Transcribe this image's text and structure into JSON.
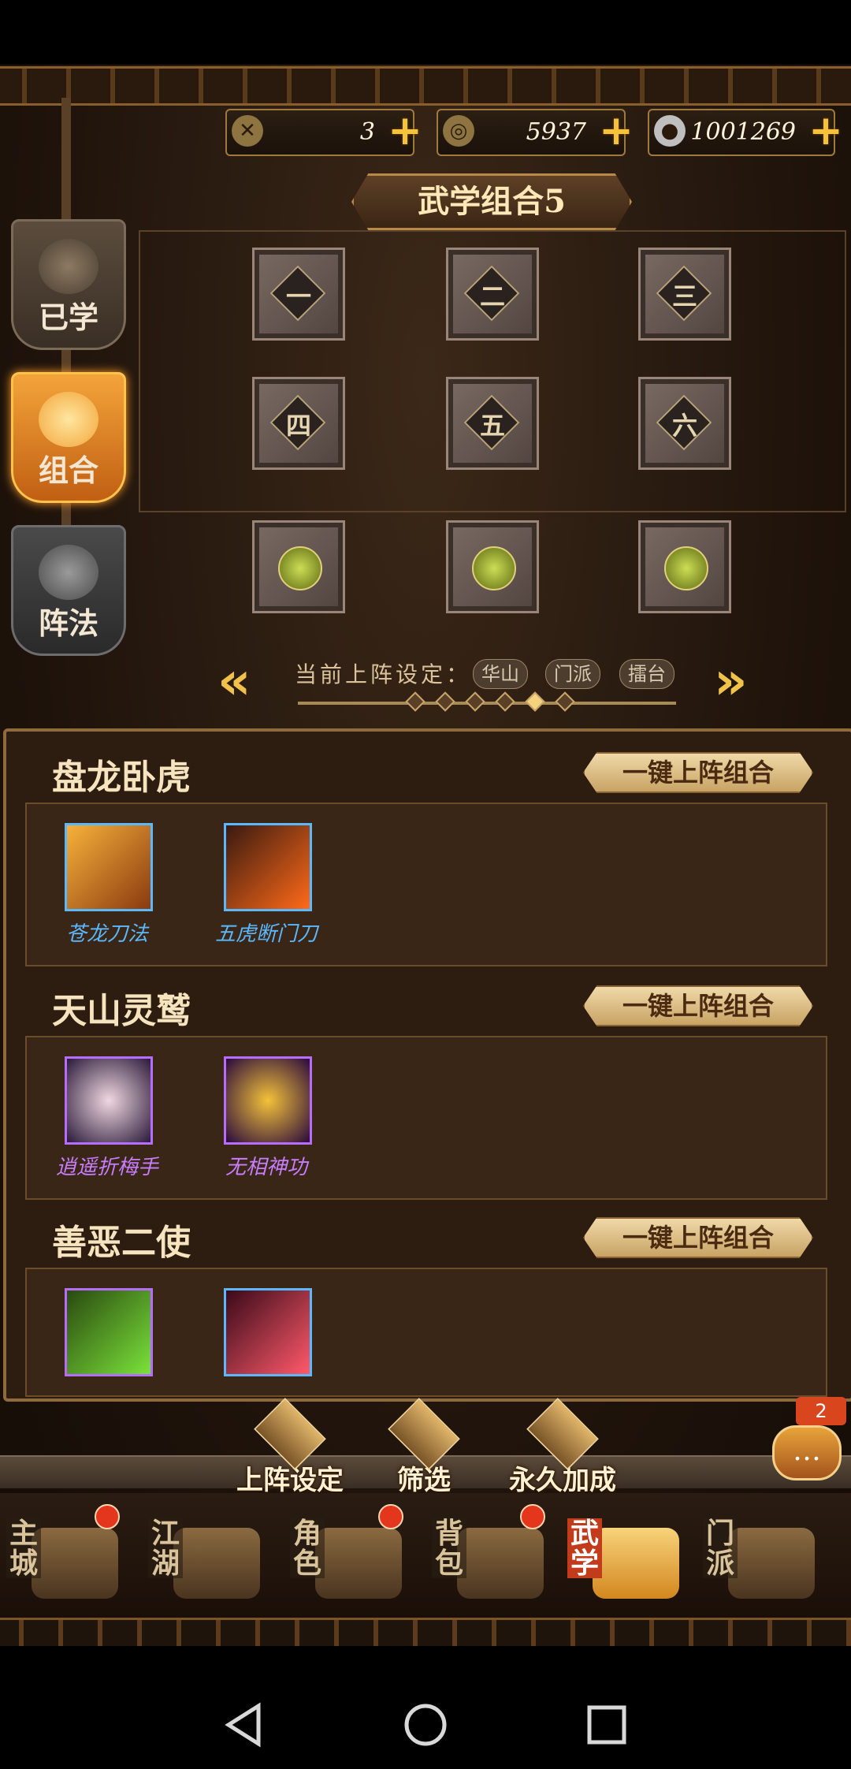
{
  "currencies": [
    {
      "icon": "swords-icon",
      "value": "3"
    },
    {
      "icon": "gold-ingot-icon",
      "value": "5937"
    },
    {
      "icon": "silver-coin-icon",
      "value": "1001269"
    }
  ],
  "side_tabs": [
    {
      "label": "已学"
    },
    {
      "label": "组合"
    },
    {
      "label": "阵法"
    }
  ],
  "title": "武学组合5",
  "slots": [
    "一",
    "二",
    "三",
    "四",
    "五",
    "六"
  ],
  "setting": {
    "label": "当前上阵设定：",
    "chips": [
      "华山",
      "门派",
      "擂台"
    ]
  },
  "combos": [
    {
      "title": "盘龙卧虎",
      "button": "一键上阵组合",
      "skills": [
        {
          "name": "苍龙刀法",
          "color": "#5ab8ff"
        },
        {
          "name": "五虎断门刀",
          "color": "#5ab8ff"
        }
      ]
    },
    {
      "title": "天山灵鹫",
      "button": "一键上阵组合",
      "skills": [
        {
          "name": "逍遥折梅手",
          "color": "#c77dff"
        },
        {
          "name": "无相神功",
          "color": "#c77dff"
        }
      ]
    },
    {
      "title": "善恶二使",
      "button": "一键上阵组合",
      "skills": [
        {
          "name": "",
          "color": "#c77dff"
        },
        {
          "name": "",
          "color": "#5ab8ff"
        }
      ]
    }
  ],
  "functions": [
    "上阵设定",
    "筛选",
    "永久加成"
  ],
  "chat_badge": "2",
  "nav": [
    {
      "label": "主城",
      "active": false,
      "dot": true
    },
    {
      "label": "江湖",
      "active": false,
      "dot": false
    },
    {
      "label": "角色",
      "active": false,
      "dot": true
    },
    {
      "label": "背包",
      "active": false,
      "dot": true
    },
    {
      "label": "武学",
      "active": true,
      "dot": false
    },
    {
      "label": "门派",
      "active": false,
      "dot": false
    }
  ]
}
